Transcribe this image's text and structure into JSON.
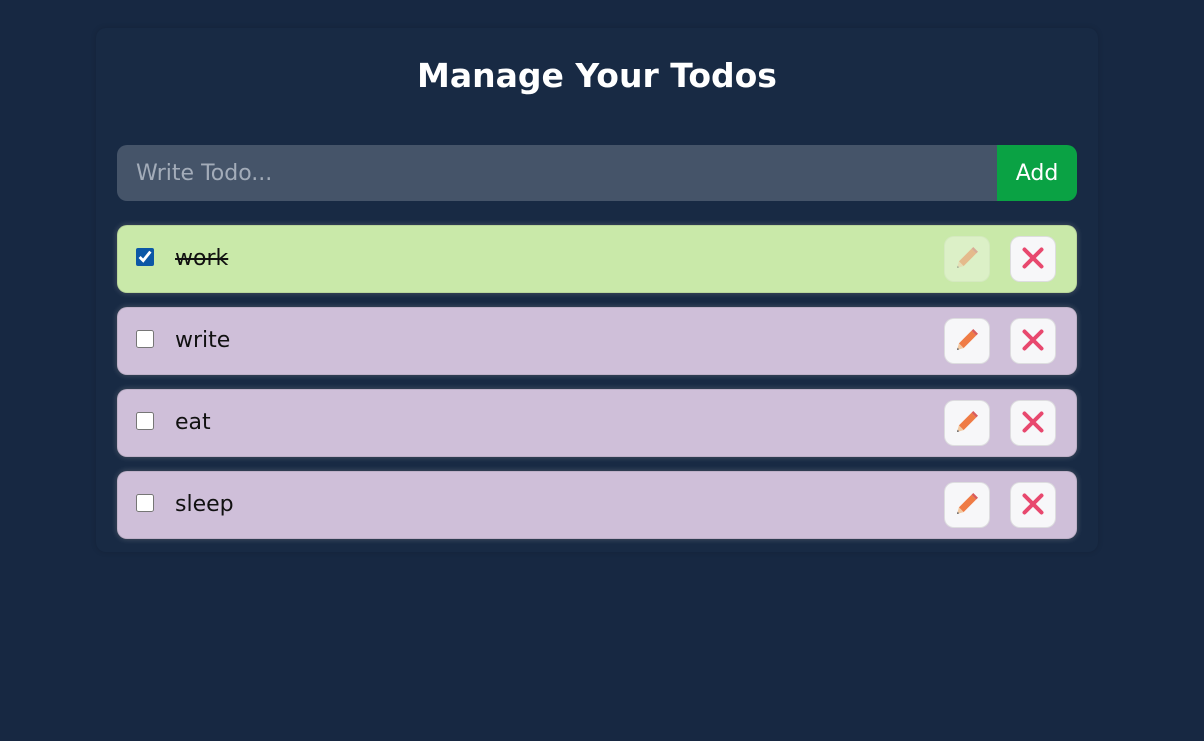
{
  "page": {
    "title": "Manage Your Todos"
  },
  "form": {
    "placeholder": "Write Todo...",
    "value": "",
    "add_label": "Add"
  },
  "todos": [
    {
      "text": "work",
      "completed": true
    },
    {
      "text": "write",
      "completed": false
    },
    {
      "text": "eat",
      "completed": false
    },
    {
      "text": "sleep",
      "completed": false
    }
  ],
  "icons": {
    "edit": "pencil-icon",
    "delete": "close-icon"
  },
  "colors": {
    "background": "#172842",
    "input_bg": "#455469",
    "add_button": "#0aa244",
    "completed_item": "#c9e9a9",
    "open_item": "#cfbfd9",
    "pencil": "#ef7b45",
    "delete_x": "#e8486e"
  }
}
